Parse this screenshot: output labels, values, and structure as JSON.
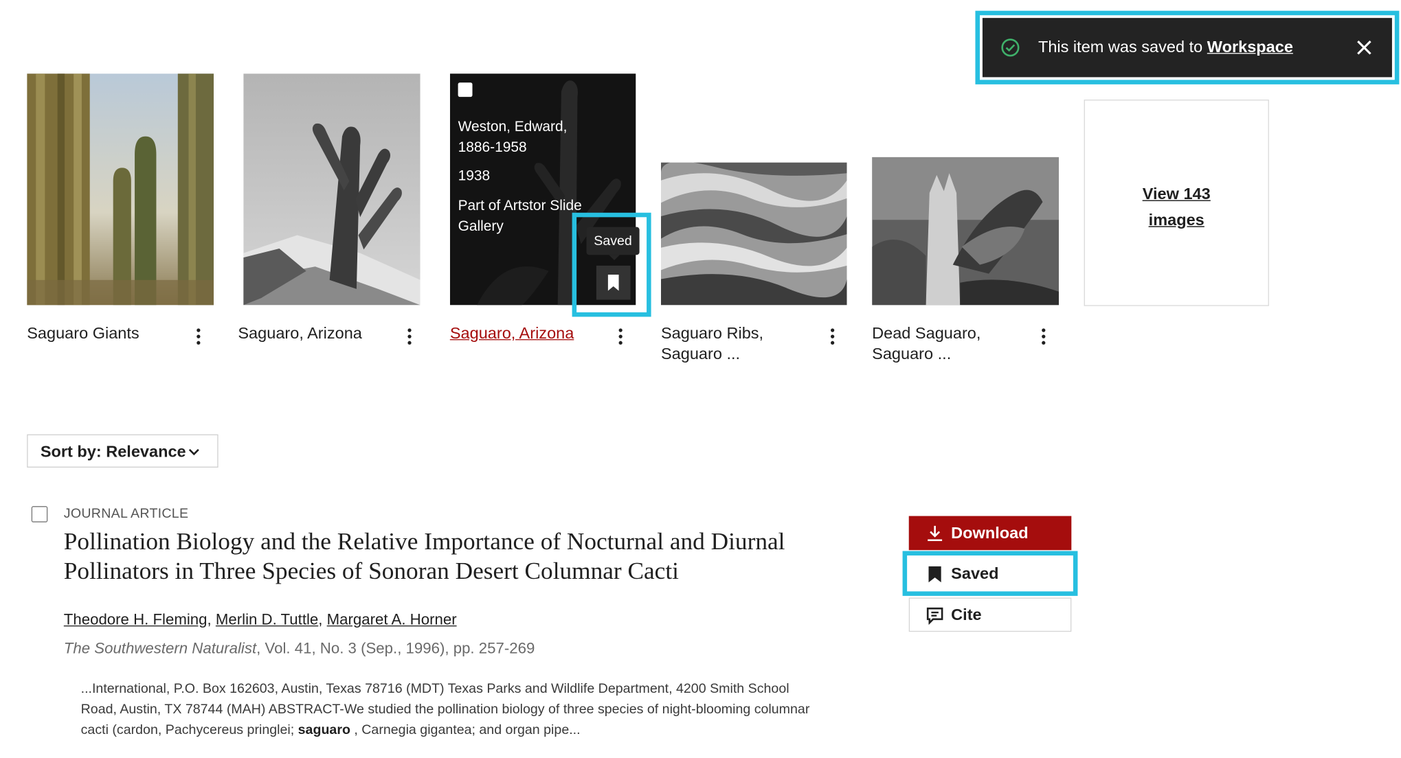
{
  "toast": {
    "message": "This item was saved to",
    "link": "Workspace"
  },
  "images": [
    {
      "title": "Saguaro Giants"
    },
    {
      "title": "Saguaro, Arizona"
    },
    {
      "title": "Saguaro, Arizona",
      "overlay": {
        "creator": "Weston, Edward,",
        "dates": "1886-1958",
        "year": "1938",
        "collection_line1": "Part of Artstor Slide",
        "collection_line2": "Gallery",
        "saved_tooltip": "Saved"
      }
    },
    {
      "title_line1": "Saguaro Ribs,",
      "title_line2": "Saguaro ..."
    },
    {
      "title_line1": "Dead Saguaro,",
      "title_line2": "Saguaro ..."
    }
  ],
  "view_more": {
    "line1": "View 143",
    "line2": "images"
  },
  "sort": {
    "label": "Sort by: Relevance"
  },
  "result": {
    "type": "JOURNAL ARTICLE",
    "title_line1": "Pollination Biology and the Relative Importance of Nocturnal and Diurnal",
    "title_line2": "Pollinators in Three Species of Sonoran Desert Columnar Cacti",
    "authors": [
      "Theodore H. Fleming",
      "Merlin D. Tuttle",
      "Margaret A. Horner"
    ],
    "journal": "The Southwestern Naturalist",
    "citation_rest": ", Vol. 41, No. 3 (Sep., 1996), pp. 257-269",
    "snippet_before": "...International, P.O. Box 162603, Austin, Texas 78716 (MDT) Texas Parks and Wildlife Department, 4200 Smith School Road, Austin, TX 78744 (MAH) ABSTRACT-We studied the pollination biology of three species of night-blooming columnar cacti (cardon, Pachycereus pringlei; ",
    "snippet_highlight": "saguaro",
    "snippet_after": " , Carnegia gigantea; and organ pipe..."
  },
  "actions": {
    "download": "Download",
    "saved": "Saved",
    "cite": "Cite"
  },
  "colors": {
    "accent_red": "#a50d0d",
    "highlight_cyan": "#27bfe0",
    "toast_bg": "#232323"
  }
}
